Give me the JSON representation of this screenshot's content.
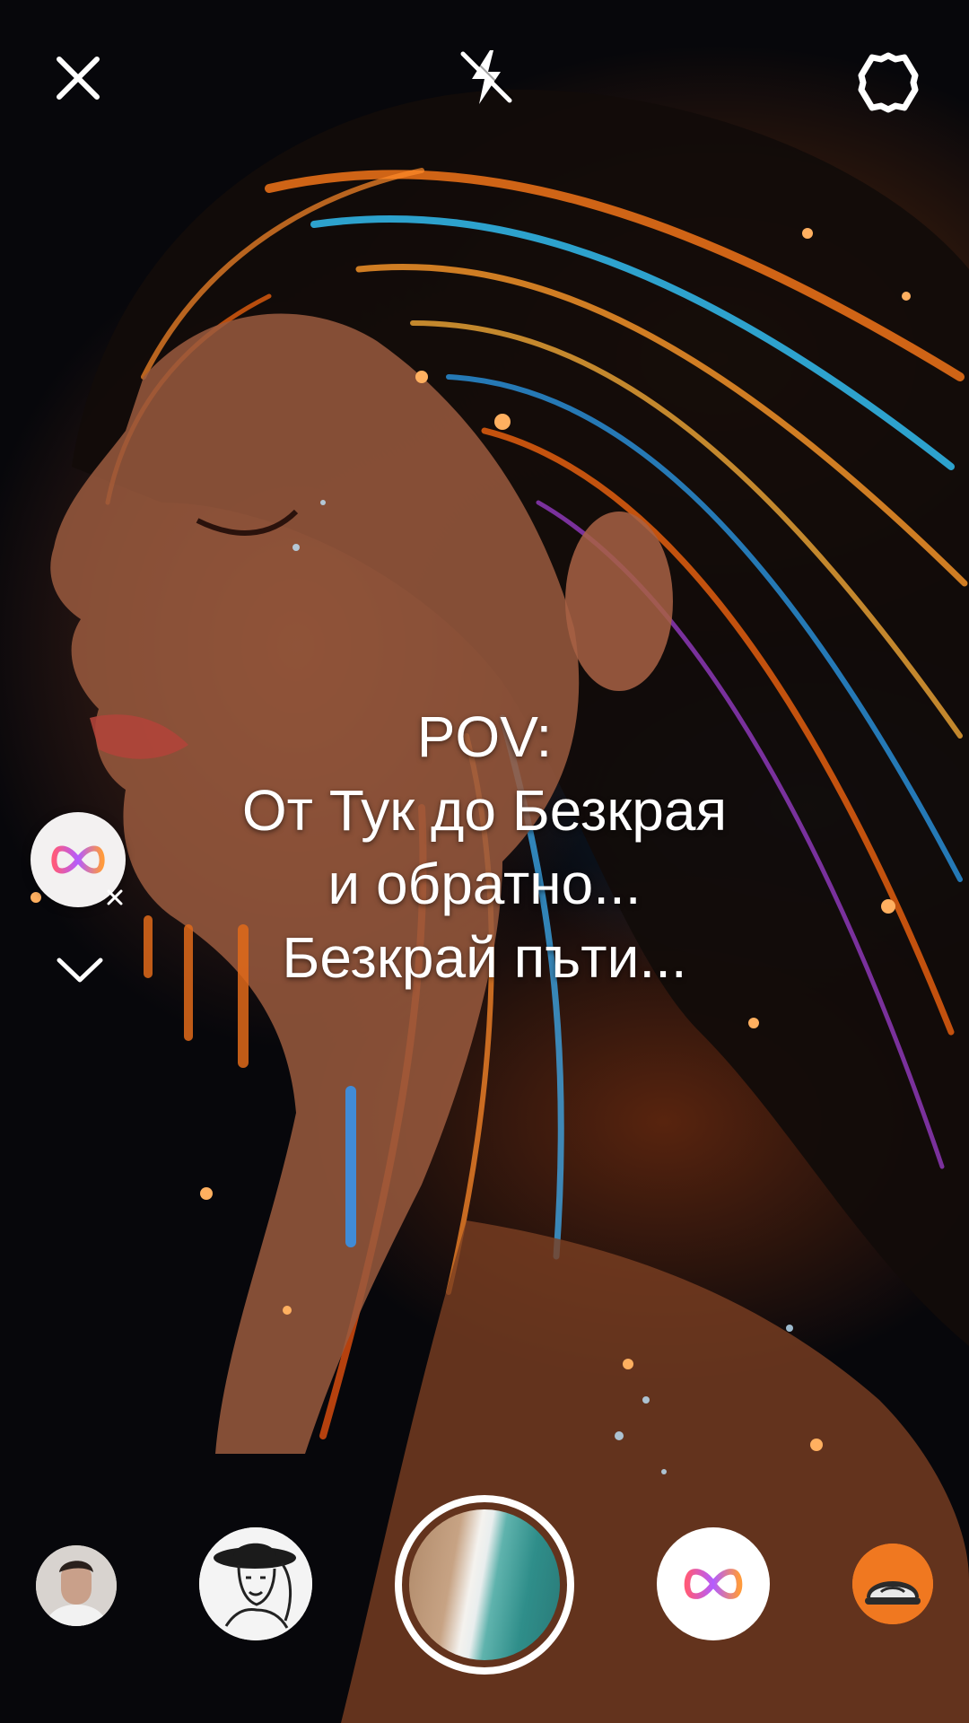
{
  "caption": {
    "lines": [
      "POV:",
      "От Тук до Безкрая",
      "и обратно...",
      "Безкрай пъти..."
    ]
  },
  "icons": {
    "close": "close-icon",
    "flash": "flash-off-icon",
    "settings": "settings-icon",
    "effect_chip": "infinity-icon",
    "chip_remove": "close-small-icon",
    "collapse": "chevron-down-icon"
  },
  "colors": {
    "infinity_gradient": [
      "#ff5a7a",
      "#b35cff",
      "#ff9a3c"
    ],
    "capture_ring": "#ffffff",
    "orange_effect": "#f07820"
  }
}
